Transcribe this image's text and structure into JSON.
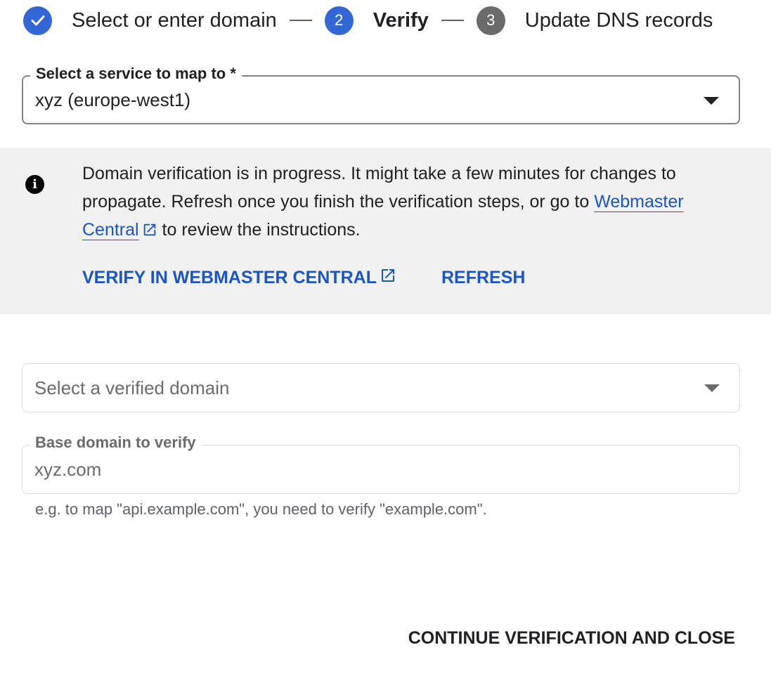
{
  "stepper": {
    "steps": [
      {
        "label": "Select or enter domain",
        "state": "done",
        "icon": "check-icon"
      },
      {
        "label": "Verify",
        "number": "2",
        "state": "active"
      },
      {
        "label": "Update DNS records",
        "number": "3",
        "state": "pending"
      }
    ]
  },
  "service_field": {
    "label": "Select a service to map to *",
    "value": "xyz (europe-west1)",
    "icon": "dropdown-arrow-icon"
  },
  "banner": {
    "icon": "info-icon",
    "text_before": "Domain verification is in progress. It might take a few minutes for changes to propagate. Refresh once you finish the verification steps, or go to ",
    "link_label": "Webmaster Central",
    "text_after": " to review the instructions.",
    "actions": {
      "verify_label": "VERIFY IN WEBMASTER CENTRAL",
      "refresh_label": "REFRESH"
    }
  },
  "verified_domain_field": {
    "placeholder": "Select a verified domain",
    "icon": "dropdown-arrow-icon"
  },
  "base_domain_field": {
    "label": "Base domain to verify",
    "value": "xyz.com",
    "hint": "e.g. to map \"api.example.com\", you need to verify \"example.com\"."
  },
  "footer": {
    "continue_label": "CONTINUE VERIFICATION AND CLOSE"
  },
  "colors": {
    "accent": "#3367d6",
    "link": "#1a56c4",
    "banner_bg": "#f1f1f1",
    "pending_step": "#6b6b6b"
  }
}
